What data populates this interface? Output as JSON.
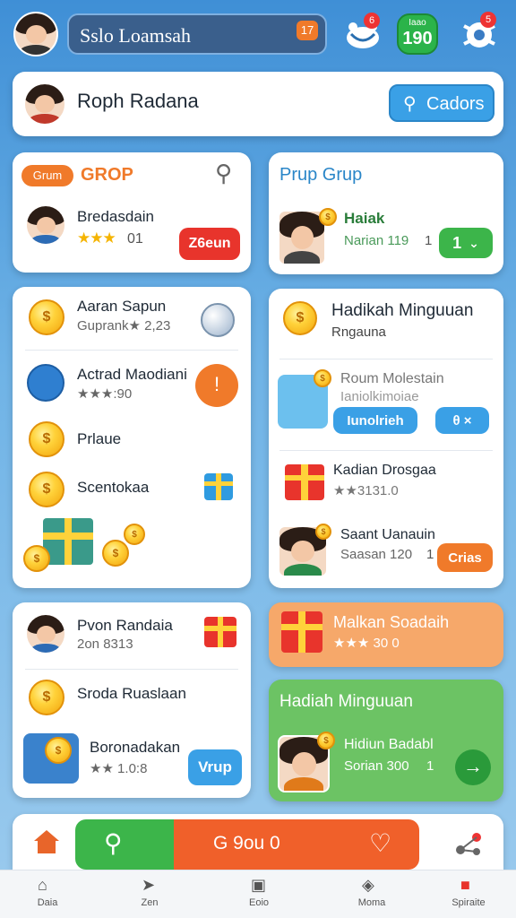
{
  "header": {
    "search_text": "Sslo Loamsah",
    "search_badge": "17",
    "icon1_badge": "6",
    "score_label": "Iaao",
    "score_value": "190",
    "icon2_badge": "5"
  },
  "profile": {
    "name": "Roph Radana",
    "button_label": "Cadors"
  },
  "group_left": {
    "tag": "Grum",
    "title": "GROP",
    "user_name": "Bredasdain",
    "user_score": "01",
    "button": "Z6eun"
  },
  "group_right": {
    "title": "Prup Grup",
    "user_name": "Haiak",
    "user_sub": "Narian 119",
    "user_num": "1",
    "select_value": "1"
  },
  "list_left": {
    "items": [
      {
        "name": "Aaran Sapun",
        "sub": "Guprank★ 2,23"
      },
      {
        "name": "Actrad Maodiani",
        "sub": "★★★:90"
      },
      {
        "name": "Prlaue"
      },
      {
        "name": "Scentokaa"
      }
    ]
  },
  "weekly": {
    "title": "Hadikah Minguuan",
    "subtitle": "Rngauna",
    "reward_name": "Roum Molestain",
    "reward_sub": "Ianiolkimoiae",
    "button1": "Iunolrieh",
    "button2_icon": "θ ×",
    "item2_name": "Kadian Drosgaa",
    "item2_sub": "★★3131.0",
    "item3_name": "Saant Uanauin",
    "item3_sub": "Saasan 120",
    "item3_num": "1",
    "item3_button": "Crias"
  },
  "list_left2": {
    "user_name": "Pvon Randaia",
    "user_sub": "2on 8313",
    "item2": "Sroda Ruaslaan",
    "item3_name": "Boronadakan",
    "item3_sub": "★★ 1.0:8",
    "item3_button": "Vrup"
  },
  "orange_banner": {
    "title": "Malkan Soadaih",
    "sub": "★★★ 30 0"
  },
  "green_card": {
    "title": "Hadiah Minguuan",
    "item_name": "Hidiun Badabl",
    "item_sub": "Sorian 300",
    "item_num": "1"
  },
  "action_bar": {
    "center_text": "G 9ou 0",
    "heart_icon": "heart-outline"
  },
  "bottom_nav": [
    {
      "label": "Daia"
    },
    {
      "label": "Zen"
    },
    {
      "label": "Eoio"
    },
    {
      "label": "Moma"
    },
    {
      "label": "Spiraite"
    }
  ]
}
